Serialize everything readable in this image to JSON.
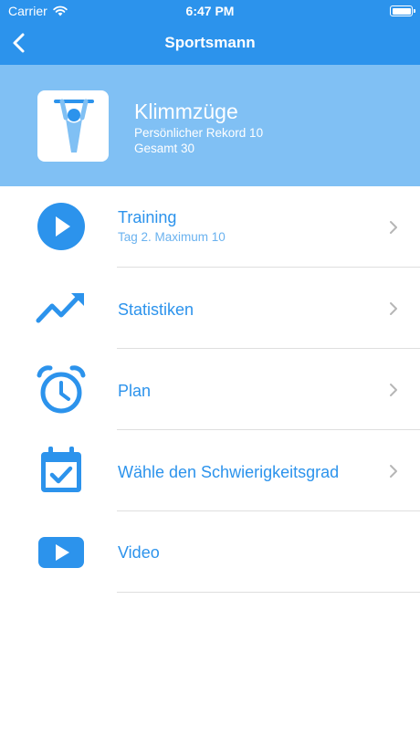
{
  "status_bar": {
    "carrier": "Carrier",
    "time": "6:47 PM"
  },
  "nav": {
    "title": "Sportsmann"
  },
  "exercise": {
    "name": "Klimmzüge",
    "record": "Persönlicher Rekord 10",
    "total": "Gesamt 30"
  },
  "menu": [
    {
      "label": "Training",
      "sublabel": "Tag 2. Maximum 10",
      "icon": "play-circle-icon"
    },
    {
      "label": "Statistiken",
      "icon": "trending-up-icon"
    },
    {
      "label": "Plan",
      "icon": "alarm-clock-icon"
    },
    {
      "label": "Wähle den Schwierigkeitsgrad",
      "icon": "calendar-check-icon"
    },
    {
      "label": "Video",
      "icon": "video-play-icon"
    }
  ],
  "colors": {
    "primary": "#2c93ec",
    "header": "#80c0f4",
    "divider": "#dedede"
  }
}
